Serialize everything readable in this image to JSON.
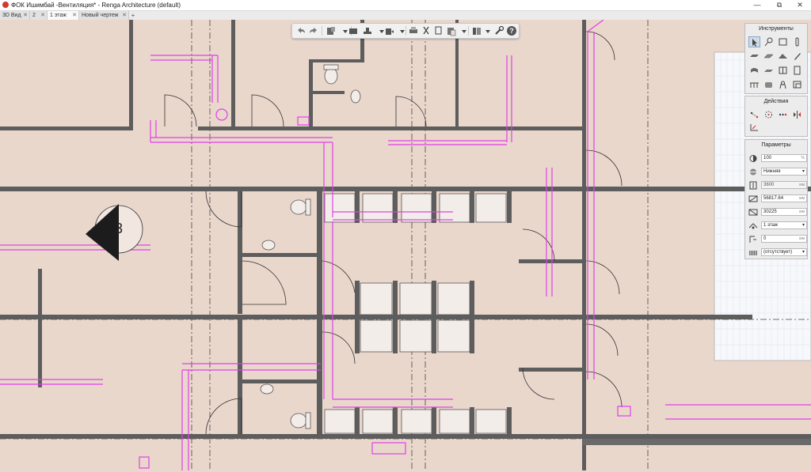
{
  "window": {
    "title": "ФОК Ишимбай -Вентиляция* - Renga Architecture (default)",
    "minimize_glyph": "—",
    "restore_glyph": "⧉",
    "close_glyph": "✕"
  },
  "tabs": [
    {
      "label": "3D Вид",
      "close": "✕",
      "active": false
    },
    {
      "label": "2",
      "close": "✕",
      "active": false
    },
    {
      "label": "1 этаж",
      "close": "✕",
      "active": true
    },
    {
      "label": "Новый чертеж",
      "close": "✕",
      "active": false
    }
  ],
  "tab_add": "+",
  "drawing": {
    "section_mark": "3",
    "colors": {
      "background": "#ead7cc",
      "walls": "#5d5d5d",
      "ducts": "#e040e8",
      "axes": "#333333",
      "grid_sheet": "#f7f8fb"
    }
  },
  "toolbar": {
    "icons": [
      "undo-icon",
      "redo-icon",
      "view-cube-icon",
      "storey-icon",
      "plan-icon",
      "section-icon",
      "print-icon",
      "cut-icon",
      "copy-icon",
      "paste-icon",
      "layers-icon",
      "wrench-icon",
      "help-icon"
    ],
    "help_glyph": "?"
  },
  "panels": {
    "tools": {
      "title": "Инструменты",
      "icons": [
        "select-arrow-icon",
        "axis-icon",
        "wall-icon",
        "column-icon",
        "beam-icon",
        "slab-icon",
        "roof-icon",
        "pencil-icon",
        "ramp-icon",
        "stair-icon",
        "window-icon",
        "door-icon",
        "railing-icon",
        "object-icon",
        "equipment-icon",
        "elbow-icon"
      ]
    },
    "actions": {
      "title": "Действия",
      "icons": [
        "move-icon",
        "rotate-icon",
        "array-icon",
        "mirror-icon",
        "trim-icon"
      ]
    },
    "params": {
      "title": "Параметры",
      "rows": [
        {
          "icon": "opacity-icon",
          "value": "100",
          "unit": "%",
          "kind": "input"
        },
        {
          "icon": "elevation-mode-icon",
          "value": "Нижняя",
          "kind": "select"
        },
        {
          "icon": "height-icon",
          "value": "3600",
          "unit": "мм",
          "kind": "readonly"
        },
        {
          "icon": "length-icon",
          "value": "56817.64",
          "unit": "мм",
          "kind": "input"
        },
        {
          "icon": "width-icon",
          "value": "30225",
          "unit": "мм",
          "kind": "input"
        },
        {
          "icon": "level-icon",
          "value": "1 этаж",
          "kind": "select"
        },
        {
          "icon": "offset-icon",
          "value": "0",
          "unit": "мм",
          "kind": "input"
        },
        {
          "icon": "material-icon",
          "value": "(отсутствует)",
          "kind": "select"
        }
      ]
    }
  }
}
